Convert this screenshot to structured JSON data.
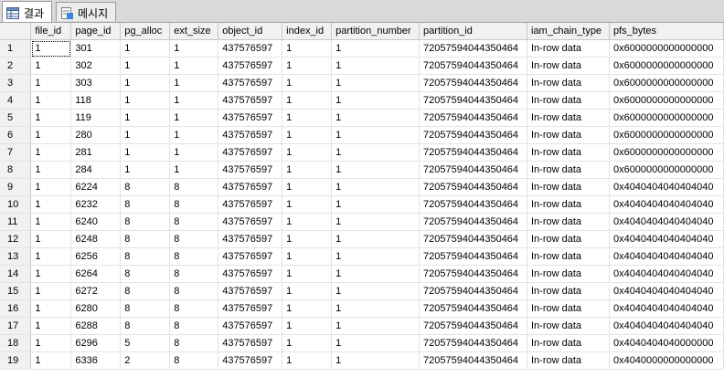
{
  "tabs": [
    {
      "label": "결과",
      "icon": "grid-results-icon"
    },
    {
      "label": "메시지",
      "icon": "messages-icon"
    }
  ],
  "grid": {
    "columns": [
      "file_id",
      "page_id",
      "pg_alloc",
      "ext_size",
      "object_id",
      "index_id",
      "partition_number",
      "partition_id",
      "iam_chain_type",
      "pfs_bytes"
    ],
    "rows": [
      [
        "1",
        "1",
        "301",
        "1",
        "1",
        "437576597",
        "1",
        "1",
        "72057594044350464",
        "In-row data",
        "0x6000000000000000"
      ],
      [
        "2",
        "1",
        "302",
        "1",
        "1",
        "437576597",
        "1",
        "1",
        "72057594044350464",
        "In-row data",
        "0x6000000000000000"
      ],
      [
        "3",
        "1",
        "303",
        "1",
        "1",
        "437576597",
        "1",
        "1",
        "72057594044350464",
        "In-row data",
        "0x6000000000000000"
      ],
      [
        "4",
        "1",
        "118",
        "1",
        "1",
        "437576597",
        "1",
        "1",
        "72057594044350464",
        "In-row data",
        "0x6000000000000000"
      ],
      [
        "5",
        "1",
        "119",
        "1",
        "1",
        "437576597",
        "1",
        "1",
        "72057594044350464",
        "In-row data",
        "0x6000000000000000"
      ],
      [
        "6",
        "1",
        "280",
        "1",
        "1",
        "437576597",
        "1",
        "1",
        "72057594044350464",
        "In-row data",
        "0x6000000000000000"
      ],
      [
        "7",
        "1",
        "281",
        "1",
        "1",
        "437576597",
        "1",
        "1",
        "72057594044350464",
        "In-row data",
        "0x6000000000000000"
      ],
      [
        "8",
        "1",
        "284",
        "1",
        "1",
        "437576597",
        "1",
        "1",
        "72057594044350464",
        "In-row data",
        "0x6000000000000000"
      ],
      [
        "9",
        "1",
        "6224",
        "8",
        "8",
        "437576597",
        "1",
        "1",
        "72057594044350464",
        "In-row data",
        "0x4040404040404040"
      ],
      [
        "10",
        "1",
        "6232",
        "8",
        "8",
        "437576597",
        "1",
        "1",
        "72057594044350464",
        "In-row data",
        "0x4040404040404040"
      ],
      [
        "11",
        "1",
        "6240",
        "8",
        "8",
        "437576597",
        "1",
        "1",
        "72057594044350464",
        "In-row data",
        "0x4040404040404040"
      ],
      [
        "12",
        "1",
        "6248",
        "8",
        "8",
        "437576597",
        "1",
        "1",
        "72057594044350464",
        "In-row data",
        "0x4040404040404040"
      ],
      [
        "13",
        "1",
        "6256",
        "8",
        "8",
        "437576597",
        "1",
        "1",
        "72057594044350464",
        "In-row data",
        "0x4040404040404040"
      ],
      [
        "14",
        "1",
        "6264",
        "8",
        "8",
        "437576597",
        "1",
        "1",
        "72057594044350464",
        "In-row data",
        "0x4040404040404040"
      ],
      [
        "15",
        "1",
        "6272",
        "8",
        "8",
        "437576597",
        "1",
        "1",
        "72057594044350464",
        "In-row data",
        "0x4040404040404040"
      ],
      [
        "16",
        "1",
        "6280",
        "8",
        "8",
        "437576597",
        "1",
        "1",
        "72057594044350464",
        "In-row data",
        "0x4040404040404040"
      ],
      [
        "17",
        "1",
        "6288",
        "8",
        "8",
        "437576597",
        "1",
        "1",
        "72057594044350464",
        "In-row data",
        "0x4040404040404040"
      ],
      [
        "18",
        "1",
        "6296",
        "5",
        "8",
        "437576597",
        "1",
        "1",
        "72057594044350464",
        "In-row data",
        "0x4040404040000000"
      ],
      [
        "19",
        "1",
        "6336",
        "2",
        "8",
        "437576597",
        "1",
        "1",
        "72057594044350464",
        "In-row data",
        "0x4040000000000000"
      ]
    ]
  }
}
